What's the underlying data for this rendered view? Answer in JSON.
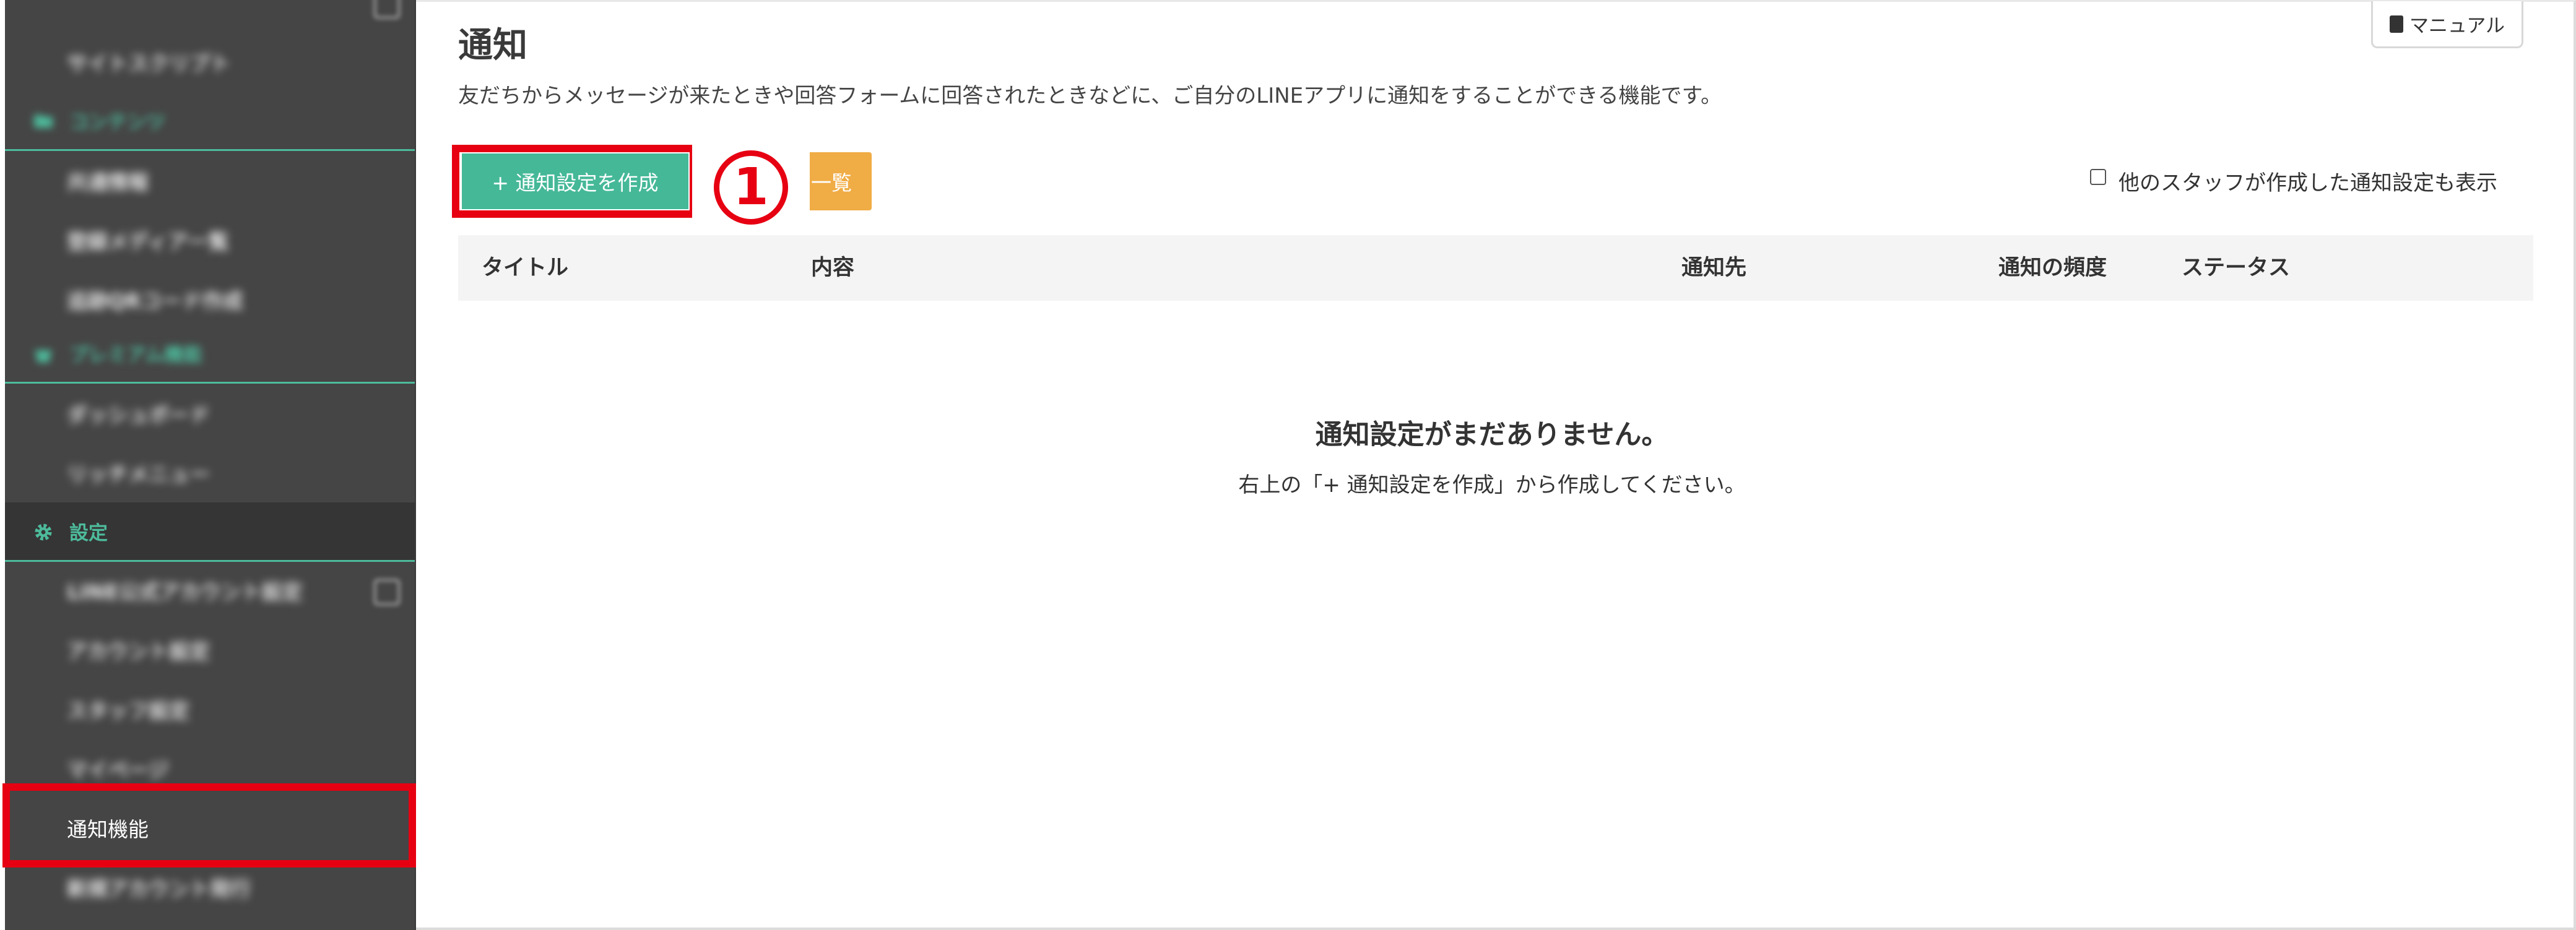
{
  "sidebar": {
    "items": [
      {
        "label": "",
        "kind": "item"
      },
      {
        "label": "サイトスクリプト",
        "kind": "item"
      },
      {
        "label": "コンテンツ",
        "kind": "section",
        "icon": "folder-icon"
      },
      {
        "label": "共通情報",
        "kind": "item"
      },
      {
        "label": "登録メディア一覧",
        "kind": "item"
      },
      {
        "label": "追跡QRコード作成",
        "kind": "item"
      },
      {
        "label": "プレミアム機能",
        "kind": "section",
        "icon": "gift-icon"
      },
      {
        "label": "ダッシュボード",
        "kind": "item"
      },
      {
        "label": "リッチメニュー",
        "kind": "item"
      },
      {
        "label": "設定",
        "kind": "section",
        "icon": "gear-icon"
      },
      {
        "label": "LINE公式アカウント設定",
        "kind": "item"
      },
      {
        "label": "アカウント設定",
        "kind": "item"
      },
      {
        "label": "スタッフ設定",
        "kind": "item"
      },
      {
        "label": "マイページ",
        "kind": "item"
      },
      {
        "label": "通知機能",
        "kind": "item"
      },
      {
        "label": "新規アカウント発行",
        "kind": "item"
      }
    ]
  },
  "header": {
    "title": "通知",
    "description": "友だちからメッセージが来たときや回答フォームに回答されたときなどに、ご自分のLINEアプリに通知をすることができる機能です。",
    "manual_label": "マニュアル"
  },
  "toolbar": {
    "create_label": "+ 通知設定を作成",
    "list_label": "一覧",
    "step_marker": "1",
    "show_other_staff_label": "他のスタッフが作成した通知設定も表示",
    "show_other_staff_checked": false
  },
  "table": {
    "columns": [
      "タイトル",
      "内容",
      "通知先",
      "通知の頻度",
      "ステータス"
    ]
  },
  "empty_state": {
    "title": "通知設定がまだありません。",
    "description": "右上の「+ 通知設定を作成」から作成してください。"
  },
  "colors": {
    "sidebar_bg": "#454545",
    "accent_green": "#45b898",
    "accent_orange": "#f0ac45",
    "highlight_red": "#e60012"
  }
}
